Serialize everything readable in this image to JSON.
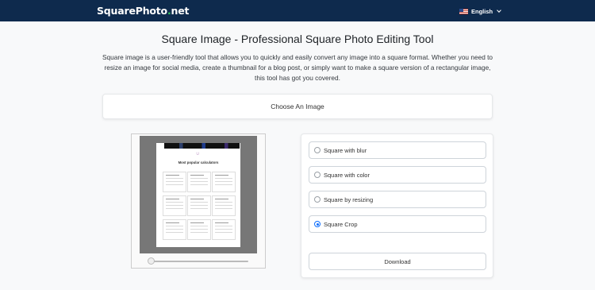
{
  "nav": {
    "brand_main": "SquarePhoto",
    "brand_dot": ".",
    "brand_tld": "net",
    "language": "English"
  },
  "page": {
    "title": "Square Image - Professional Square Photo Editing Tool",
    "intro": "Square image is a user-friendly tool that allows you to quickly and easily convert any image into a square format. Whether you need to resize an image for social media, create a thumbnail for a blog post, or simply want to make a square version of a rectangular image, this tool has got you covered.",
    "choose_label": "Choose An Image"
  },
  "preview": {
    "image_heading": "Most popular calculators"
  },
  "options": {
    "items": [
      {
        "label": "Square with blur",
        "selected": false
      },
      {
        "label": "Square with color",
        "selected": false
      },
      {
        "label": "Square by resizing",
        "selected": false
      },
      {
        "label": "Square Crop",
        "selected": true
      }
    ],
    "download_label": "Download"
  },
  "colors": {
    "navbar": "#0e2a4d",
    "accent": "#0d6efd",
    "brand_dot": "#36c95e"
  }
}
